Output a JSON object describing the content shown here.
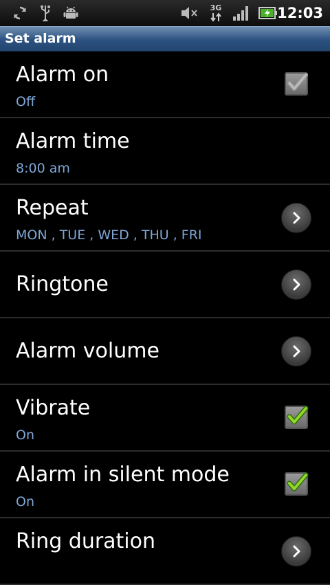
{
  "status_bar": {
    "time": "12:03",
    "network": "3G",
    "icons": [
      "sync-icon",
      "usb-icon",
      "android-debug-icon",
      "muted-speaker-icon",
      "3g-data-icon",
      "signal-icon",
      "battery-charging-icon"
    ]
  },
  "header": {
    "title": "Set alarm"
  },
  "settings": [
    {
      "title": "Alarm on",
      "summary": "Off",
      "control": "checkbox",
      "checked": false
    },
    {
      "title": "Alarm time",
      "summary": "8:00 am",
      "control": "none"
    },
    {
      "title": "Repeat",
      "summary": "MON , TUE , WED , THU , FRI",
      "control": "chevron"
    },
    {
      "title": "Ringtone",
      "control": "chevron"
    },
    {
      "title": "Alarm volume",
      "control": "chevron"
    },
    {
      "title": "Vibrate",
      "summary": "On",
      "control": "checkbox",
      "checked": true
    },
    {
      "title": "Alarm in silent mode",
      "summary": "On",
      "control": "checkbox",
      "checked": true
    },
    {
      "title": "Ring duration",
      "control": "chevron"
    }
  ],
  "colors": {
    "title_bar": "#2c5281",
    "summary_text": "#7ea7d8",
    "check": "#8fd82a",
    "divider": "#2e2e2e"
  }
}
